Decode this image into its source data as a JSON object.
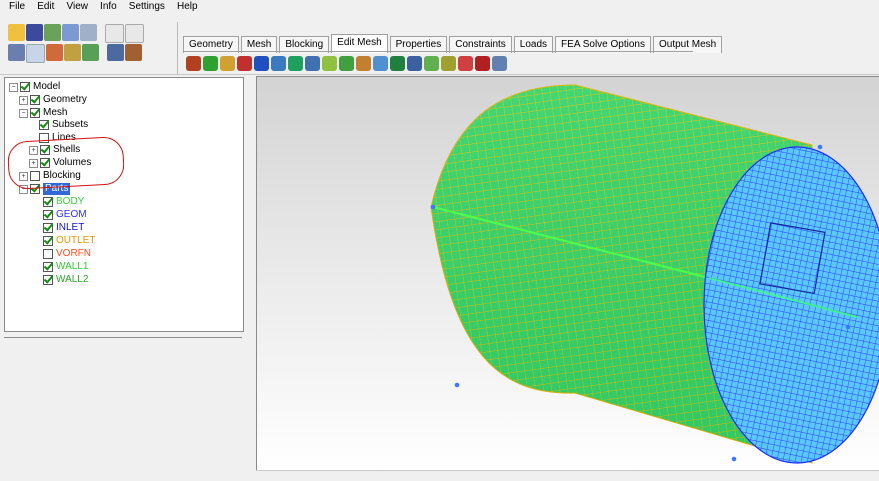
{
  "menu": [
    "File",
    "Edit",
    "View",
    "Info",
    "Settings",
    "Help"
  ],
  "tabs": [
    "Geometry",
    "Mesh",
    "Blocking",
    "Edit Mesh",
    "Properties",
    "Constraints",
    "Loads",
    "FEA Solve Options",
    "Output Mesh"
  ],
  "active_tab": "Edit Mesh",
  "tree": {
    "model": "Model",
    "geometry": "Geometry",
    "mesh": "Mesh",
    "subsets": "Subsets",
    "lines": "Lines",
    "shells": "Shells",
    "volumes": "Volumes",
    "blocking": "Blocking",
    "parts": "Parts",
    "part_items": [
      {
        "label": "BODY",
        "color": "#3dcf3d"
      },
      {
        "label": "GEOM",
        "color": "#3030ff"
      },
      {
        "label": "INLET",
        "color": "#1414b8"
      },
      {
        "label": "OUTLET",
        "color": "#e49a00"
      },
      {
        "label": "VORFN",
        "color": "#ff4a1a"
      },
      {
        "label": "WALL1",
        "color": "#32c832"
      },
      {
        "label": "WALL2",
        "color": "#2aa72a"
      }
    ]
  },
  "colors": {
    "mesh_side": "#32d46a",
    "mesh_edge_lines": "#e0c000",
    "mesh_end": "#3b5cff",
    "annotation": "#d01010",
    "selection": "#3168d5"
  }
}
